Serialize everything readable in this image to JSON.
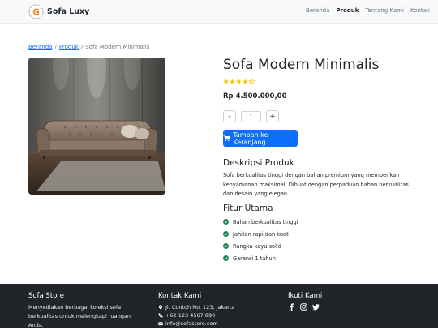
{
  "navbar": {
    "brand": "Sofa Luxy",
    "links": [
      {
        "label": "Beranda",
        "active": false
      },
      {
        "label": "Produk",
        "active": true
      },
      {
        "label": "Tentang Kami",
        "active": false
      },
      {
        "label": "Kontak",
        "active": false
      }
    ]
  },
  "breadcrumb": {
    "home": "Beranda",
    "category": "Produk",
    "current": "Sofa Modern Minimalis",
    "separator": "/"
  },
  "product": {
    "title": "Sofa Modern Minimalis",
    "rating": 4.5,
    "price": "Rp 4.500.000,00",
    "quantity": "1",
    "minus": "-",
    "plus": "+",
    "add_to_cart": "Tambah ke Keranjang"
  },
  "description": {
    "heading": "Deskripsi Produk",
    "text": "Sofa berkualitas tinggi dengan bahan premium yang memberikan kenyamanan maksimal. Dibuat dengan perpaduan bahan berkualitas dan desain yang elegan."
  },
  "features": {
    "heading": "Fitur Utama",
    "items": [
      "Bahan berkualitas tinggi",
      "Jahitan rapi dan kuat",
      "Rangka kayu solid",
      "Garansi 1 tahun"
    ]
  },
  "footer": {
    "store_heading": "Sofa Store",
    "store_text": "Menyediakan berbagai koleksi sofa berkualitas untuk melengkapi ruangan Anda.",
    "contact_heading": "Kontak Kami",
    "address": "Jl. Contoh No. 123, Jakarta",
    "phone": "+62 123 4567 890",
    "email": "info@sofastore.com",
    "follow_heading": "Ikuti Kami"
  },
  "colors": {
    "primary": "#0d6efd",
    "star": "#ffc107",
    "check": "#198754",
    "footer_bg": "#212529"
  }
}
